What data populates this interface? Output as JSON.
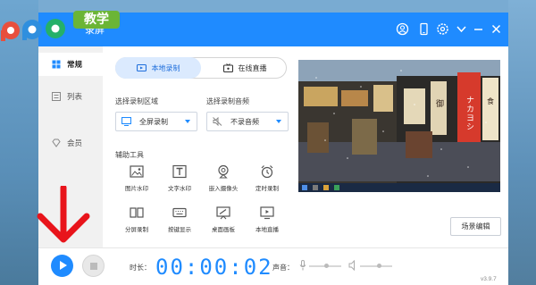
{
  "app": {
    "title": "录屏",
    "badge": "教学",
    "version": "v3.9.7"
  },
  "titlebar_icons": [
    "user-icon",
    "phone-icon",
    "settings-icon",
    "dropdown-icon",
    "minimize-icon",
    "close-icon"
  ],
  "sidebar": {
    "items": [
      {
        "label": "常规",
        "icon": "grid-icon",
        "active": true
      },
      {
        "label": "列表",
        "icon": "list-icon",
        "active": false
      },
      {
        "label": "会员",
        "icon": "diamond-icon",
        "active": false
      }
    ]
  },
  "tabs": [
    {
      "label": "本地录制",
      "icon": "video-icon",
      "active": true
    },
    {
      "label": "在线直播",
      "icon": "tv-icon",
      "active": false
    }
  ],
  "record_area": {
    "label": "选择录制区域",
    "value": "全屏录制",
    "icon": "monitor-icon"
  },
  "record_audio": {
    "label": "选择录制音频",
    "value": "不录音频",
    "icon": "mute-icon"
  },
  "tools": {
    "label": "辅助工具",
    "items": [
      {
        "label": "图片水印",
        "icon": "image-icon"
      },
      {
        "label": "文字水印",
        "icon": "text-icon"
      },
      {
        "label": "嵌入摄像头",
        "icon": "webcam-icon"
      },
      {
        "label": "定时录制",
        "icon": "alarm-icon"
      },
      {
        "label": "分屏录制",
        "icon": "split-screen-icon"
      },
      {
        "label": "按键显示",
        "icon": "keyboard-icon"
      },
      {
        "label": "桌面画板",
        "icon": "whiteboard-icon"
      },
      {
        "label": "本地直播",
        "icon": "monitor-play-icon"
      }
    ]
  },
  "preview": {
    "sign_texts": [
      "ナカヨシ",
      "御",
      "食"
    ]
  },
  "scene_edit_label": "场景编辑",
  "controls": {
    "duration_label": "时长：",
    "timer": "00:00:02",
    "volume_label": "声音：",
    "mic_volume": 0.55,
    "speaker_volume": 0.6
  },
  "colors": {
    "accent": "#1f8bff",
    "badge": "#6bb536",
    "arrow": "#e8141b"
  }
}
